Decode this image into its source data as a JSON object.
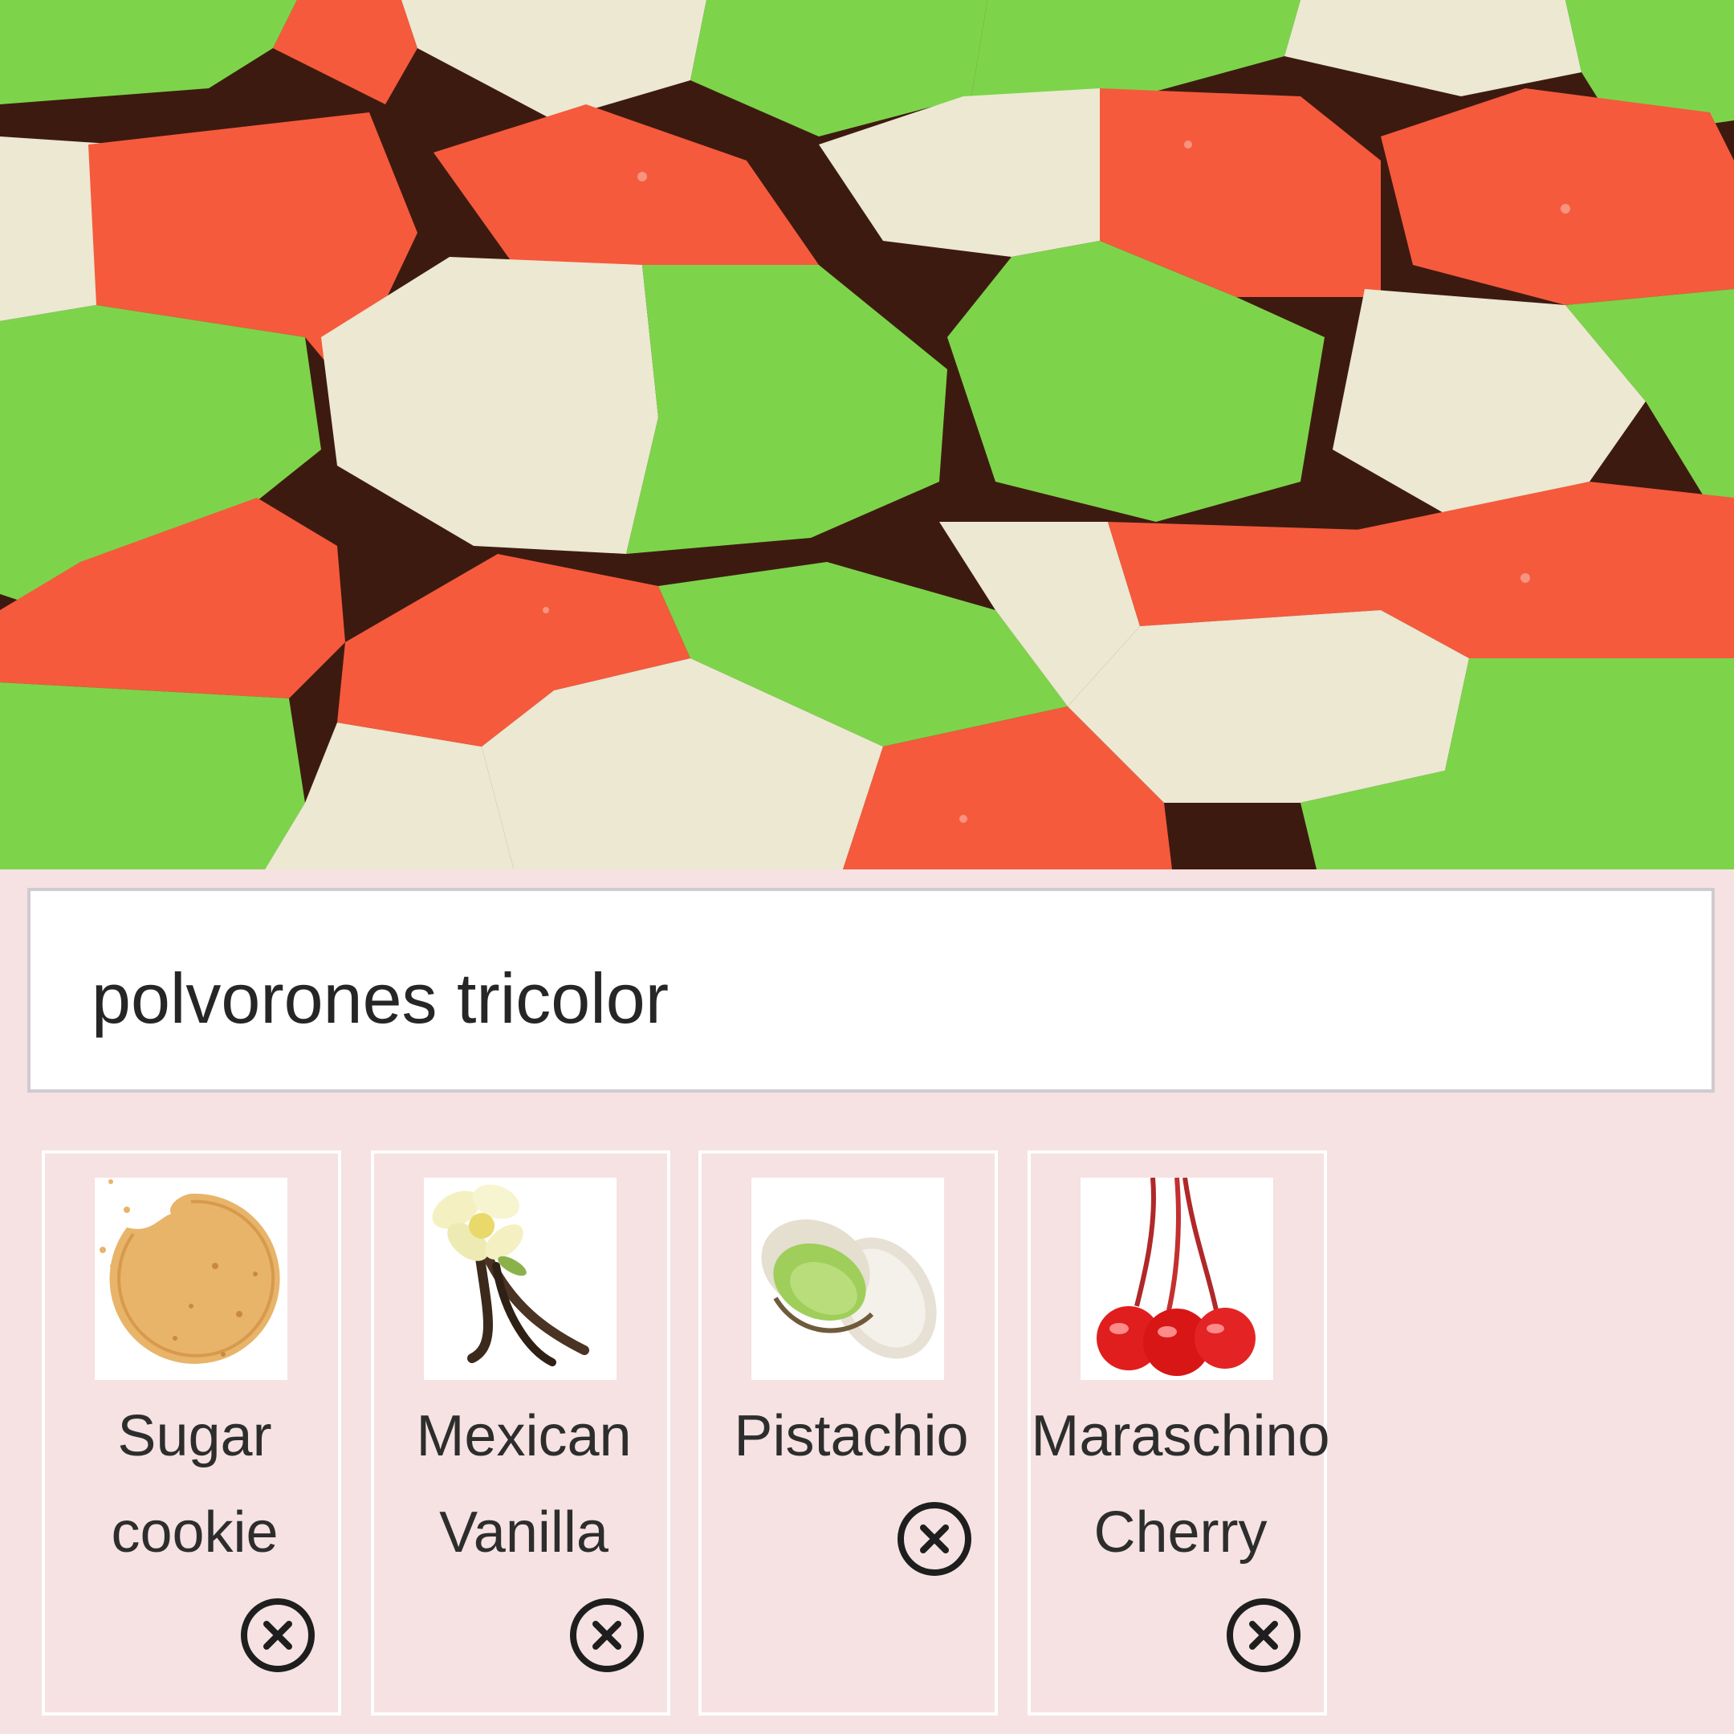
{
  "search": {
    "value": "polvorones tricolor"
  },
  "hero": {
    "icon": "tricolor-cookies-photo",
    "colors": {
      "red": "#f55a3c",
      "green": "#7dd44a",
      "white": "#ece8d2"
    }
  },
  "chips": [
    {
      "label": "Sugar\ncookie",
      "icon": "sugar-cookie-image",
      "remove_icon": "close-circle-icon"
    },
    {
      "label": "Mexican\nVanilla",
      "icon": "vanilla-flower-image",
      "remove_icon": "close-circle-icon"
    },
    {
      "label": "Pistachio",
      "icon": "pistachio-image",
      "remove_icon": "close-circle-icon"
    },
    {
      "label": "Maraschino\nCherry",
      "icon": "cherry-image",
      "remove_icon": "close-circle-icon"
    }
  ],
  "colors": {
    "background": "#f6e2e2",
    "chip_border": "#ffffff",
    "text": "#2d2d2d"
  }
}
